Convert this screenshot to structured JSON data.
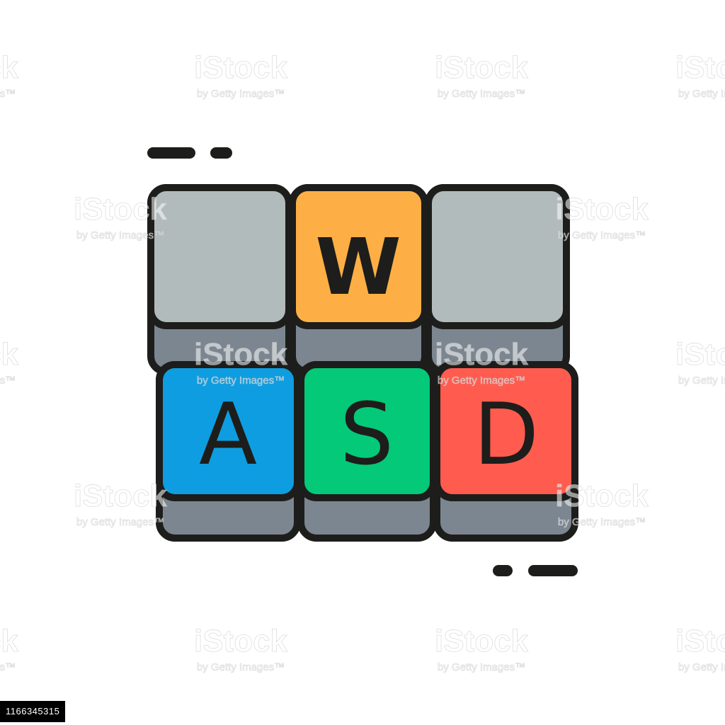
{
  "keys": {
    "w": {
      "label": "W",
      "color": "#FDAF45"
    },
    "a": {
      "label": "A",
      "color": "#0E9DE0"
    },
    "s": {
      "label": "S",
      "color": "#03C978"
    },
    "d": {
      "label": "D",
      "color": "#FF5C4F"
    }
  },
  "colors": {
    "outline": "#1D1D1B",
    "blank_key": "#B1BBBB",
    "key_side": "#7B8690",
    "background": "#FFFFFF"
  },
  "watermark": {
    "title": "iStock",
    "subtitle": "by Getty Images™"
  },
  "image_id": "1166345315"
}
